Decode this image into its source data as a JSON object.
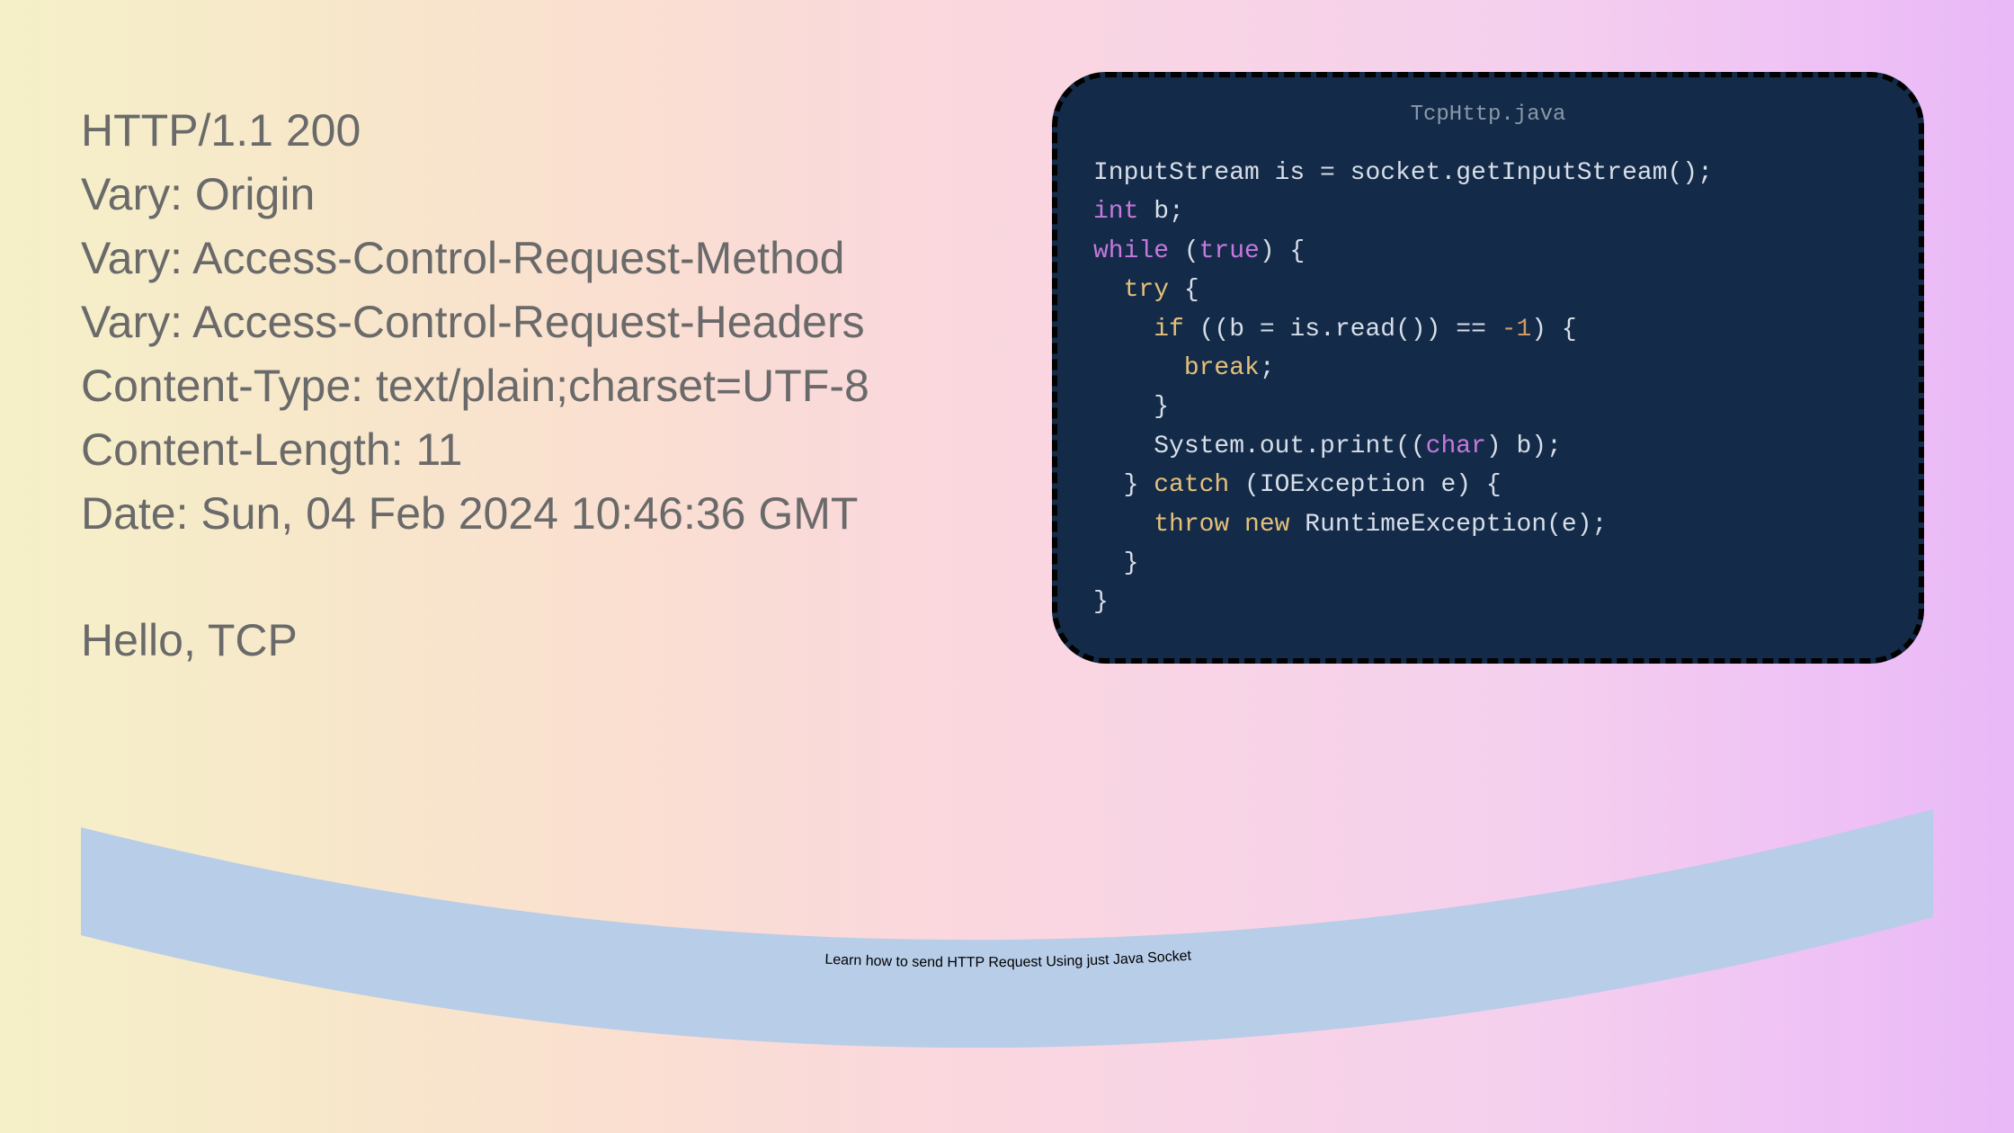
{
  "http": {
    "status": "HTTP/1.1 200",
    "vary1": "Vary: Origin",
    "vary2": "Vary: Access-Control-Request-Method",
    "vary3": "Vary: Access-Control-Request-Headers",
    "content_type": "Content-Type: text/plain;charset=UTF-8",
    "content_length": "Content-Length: 11",
    "date": "Date: Sun, 04 Feb 2024 10:46:36 GMT",
    "body": "Hello, TCP"
  },
  "code": {
    "filename": "TcpHttp.java",
    "line1_a": "InputStream is = socket.getInputStream();",
    "line2_a": "int",
    "line2_b": " b;",
    "line3_a": "while",
    "line3_b": " (",
    "line3_c": "true",
    "line3_d": ") {",
    "line4_a": "  ",
    "line4_b": "try",
    "line4_c": " {",
    "line5_a": "    ",
    "line5_b": "if",
    "line5_c": " ((b = is.read()) == ",
    "line5_d": "-1",
    "line5_e": ") {",
    "line6_a": "      ",
    "line6_b": "break",
    "line6_c": ";",
    "line7_a": "    }",
    "line8_a": "    System.out.print((",
    "line8_b": "char",
    "line8_c": ") b);",
    "line9_a": "  } ",
    "line9_b": "catch",
    "line9_c": " (IOException e) {",
    "line10_a": "    ",
    "line10_b": "throw",
    "line10_c": " ",
    "line10_d": "new",
    "line10_e": " RuntimeException(e);",
    "line11_a": "  }",
    "line12_a": "}"
  },
  "banner": {
    "text": "Learn how to send HTTP Request Using just Java Socket"
  }
}
